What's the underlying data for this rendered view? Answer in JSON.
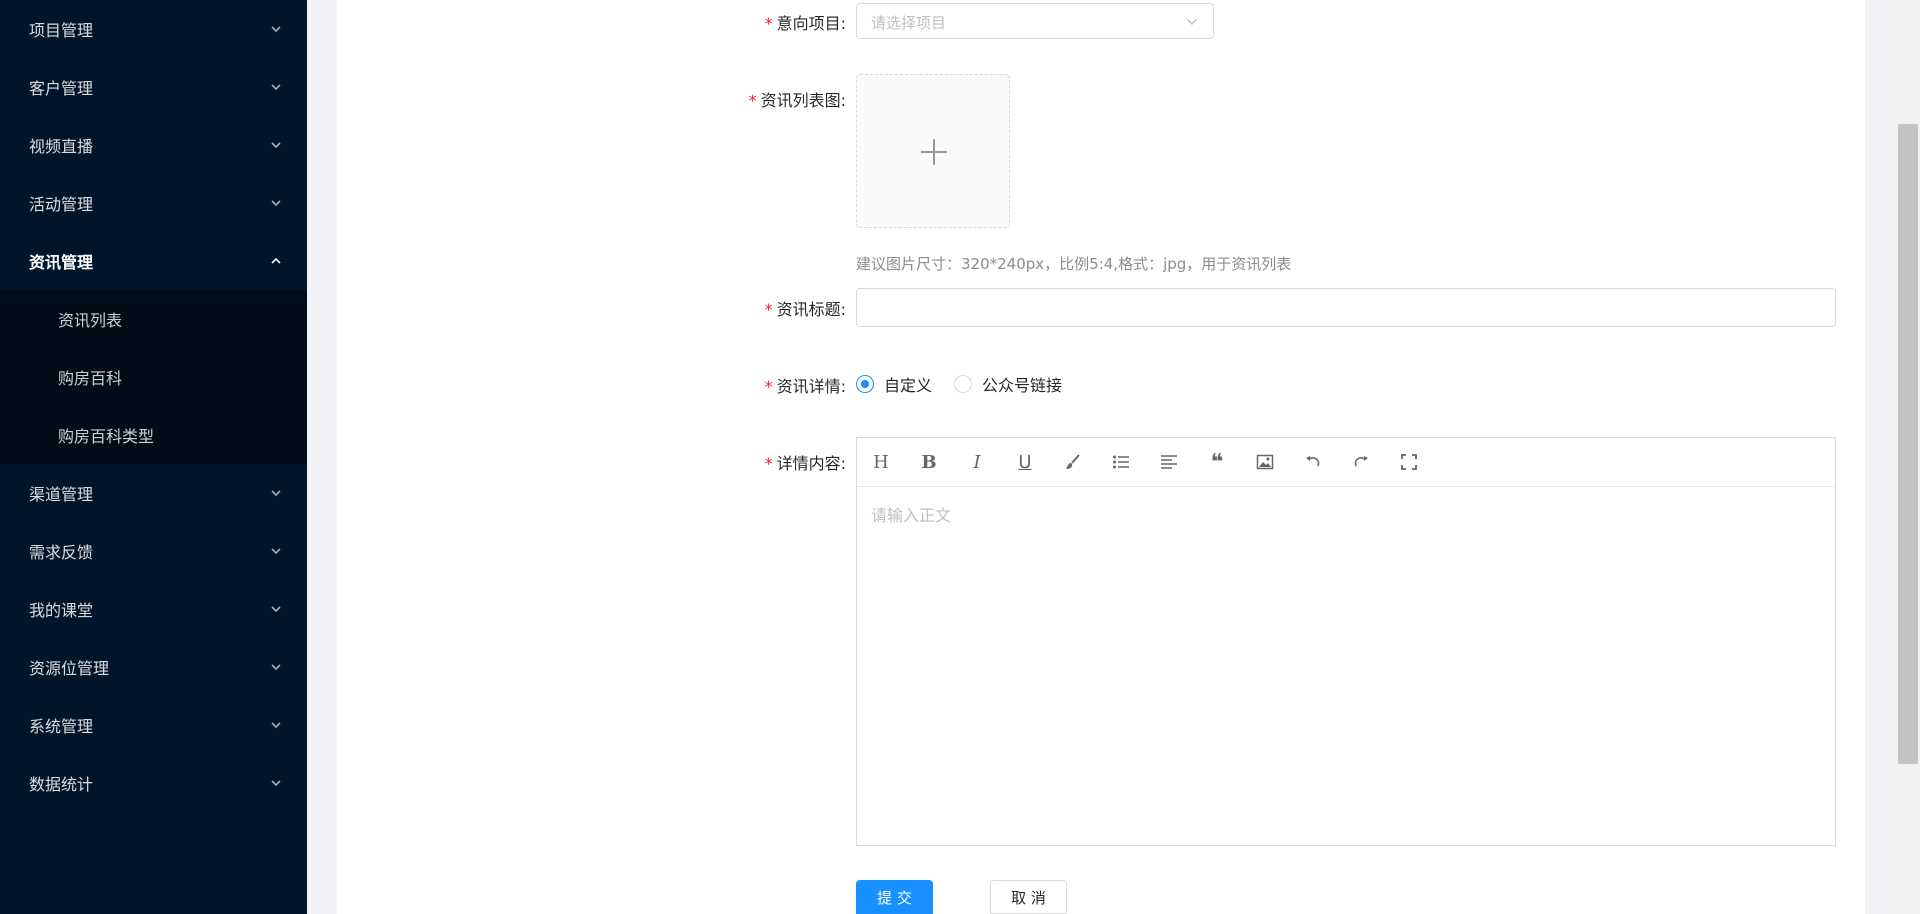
{
  "sidebar": {
    "items": [
      {
        "label": "项目管理"
      },
      {
        "label": "客户管理"
      },
      {
        "label": "视频直播"
      },
      {
        "label": "活动管理"
      },
      {
        "label": "资讯管理"
      },
      {
        "label": "渠道管理"
      },
      {
        "label": "需求反馈"
      },
      {
        "label": "我的课堂"
      },
      {
        "label": "资源位管理"
      },
      {
        "label": "系统管理"
      },
      {
        "label": "数据统计"
      }
    ],
    "submenu": [
      {
        "label": "资讯列表"
      },
      {
        "label": "购房百科"
      },
      {
        "label": "购房百科类型"
      }
    ]
  },
  "form": {
    "required_mark": "*",
    "project": {
      "label": "意向项目:",
      "placeholder": "请选择项目"
    },
    "list_image": {
      "label": "资讯列表图:",
      "hint": "建议图片尺寸：320*240px，比例5:4,格式：jpg，用于资讯列表"
    },
    "title": {
      "label": "资讯标题:",
      "value": ""
    },
    "detail": {
      "label": "资讯详情:",
      "options": [
        {
          "label": "自定义"
        },
        {
          "label": "公众号链接"
        }
      ],
      "selected": "自定义"
    },
    "content": {
      "label": "详情内容:",
      "placeholder": "请输入正文"
    },
    "submit_label": "提 交",
    "cancel_label": "取 消"
  },
  "editor_toolbar": {
    "heading": "H",
    "bold": "B",
    "italic": "I",
    "underline": "U",
    "quote": "❝"
  },
  "colors": {
    "sidebar": "#001529",
    "submenu": "#000c17",
    "primary": "#1890ff",
    "required": "#f5222d"
  }
}
